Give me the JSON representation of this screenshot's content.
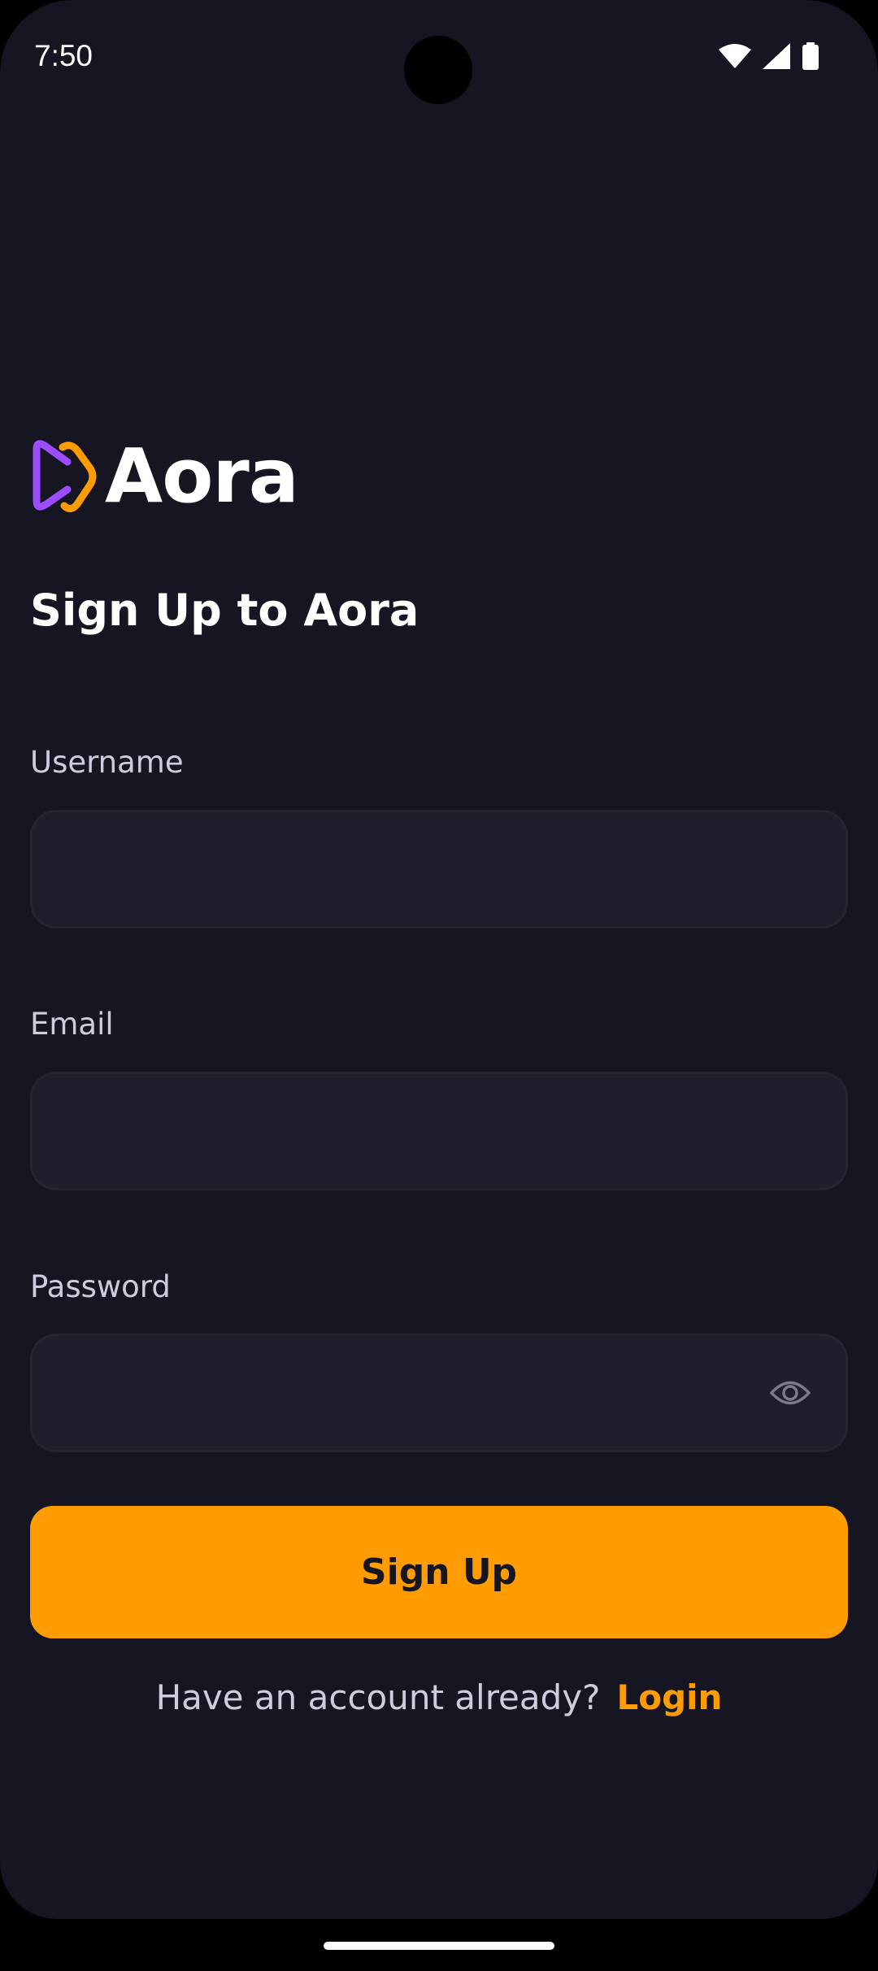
{
  "status_bar": {
    "time": "7:50",
    "icons": [
      "wifi-icon",
      "signal-icon",
      "battery-icon"
    ]
  },
  "brand": {
    "name": "Aora",
    "logo_colors": [
      "#9b4dff",
      "#ff9c01"
    ]
  },
  "screen_title": "Sign Up to Aora",
  "form": {
    "username": {
      "label": "Username",
      "value": "",
      "placeholder": ""
    },
    "email": {
      "label": "Email",
      "value": "",
      "placeholder": ""
    },
    "password": {
      "label": "Password",
      "value": "",
      "placeholder": "",
      "toggle_icon": "eye-icon"
    }
  },
  "signup_button": {
    "label": "Sign Up"
  },
  "footer": {
    "prompt": "Have an account already?",
    "link": "Login"
  },
  "colors": {
    "background": "#161622",
    "field_background": "#1e1e2d",
    "accent": "#ff9c01",
    "muted_text": "#cdcde0"
  }
}
